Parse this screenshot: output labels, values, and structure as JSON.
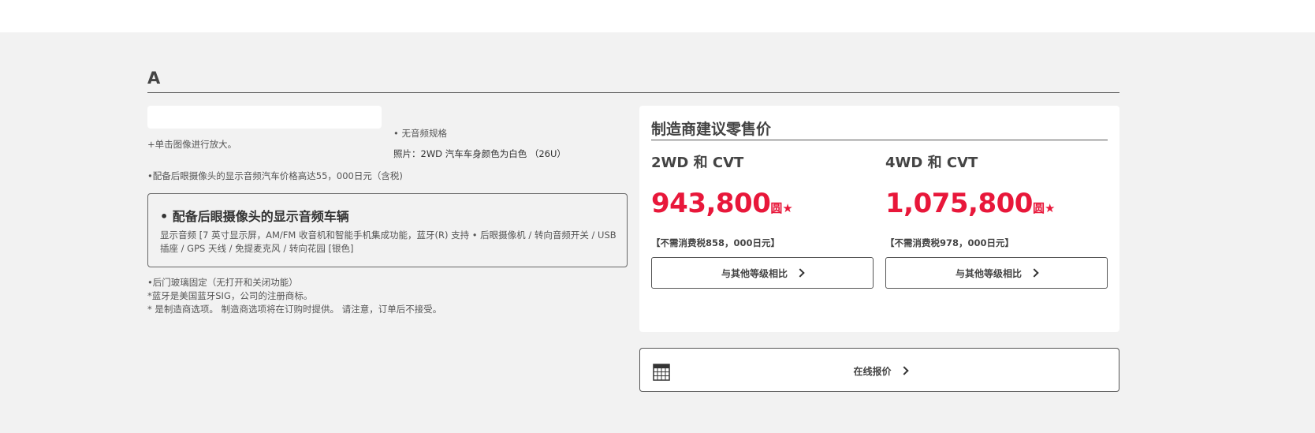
{
  "grade": {
    "title": "A"
  },
  "image_panel": {
    "zoom_note": "+单击图像进行放大。"
  },
  "spec_notes": {
    "no_audio": "• 无音频规格",
    "photo_note": "照片：2WD 汽车车身颜色为白色 （26U）"
  },
  "option_price_note": "•配备后眼摄像头的显示音频汽车价格高达55，000日元（含税)",
  "audio_option": {
    "title": "• 配备后眼摄像头的显示音频车辆",
    "description": "显示音频 [7 英寸显示屏，AM/FM 收音机和智能手机集成功能，蓝牙(R) 支持 • 后眼摄像机 / 转向音频开关 / USB 插座 / GPS 天线 / 免提麦克风 / 转向花园 [银色]"
  },
  "footnotes": [
    "•后门玻璃固定（无打开和关闭功能）",
    "*蓝牙是美国蓝牙SIG，公司的注册商标。",
    "* 是制造商选项。 制造商选项将在订购时提供。 请注意，订单后不接受。"
  ],
  "msrp": {
    "title": "制造商建议零售价",
    "trims": [
      {
        "name": "2WD 和 CVT",
        "price": "943,800",
        "unit": "圆",
        "star": "★",
        "tax_note": "【不需消费税858，000日元】",
        "compare_label": "与其他等级相比"
      },
      {
        "name": "4WD 和 CVT",
        "price": "1,075,800",
        "unit": "圆",
        "star": "★",
        "tax_note": "【不需消费税978，000日元】",
        "compare_label": "与其他等级相比"
      }
    ]
  },
  "estimate": {
    "label": "在线报价",
    "icon": "calculator-icon"
  },
  "colors": {
    "accent_red": "#e8173a",
    "background": "#f2f2f2"
  }
}
